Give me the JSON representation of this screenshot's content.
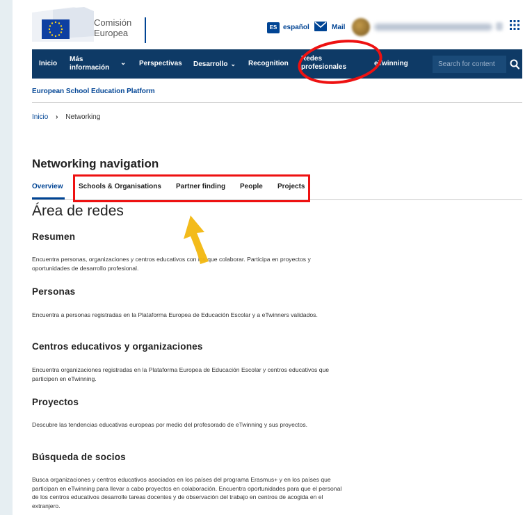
{
  "header": {
    "logo_line1": "Comisión",
    "logo_line2": "Europea",
    "lang_code": "ES",
    "lang_label": "español",
    "mail_label": "Mail"
  },
  "navbar": {
    "items": [
      "Inicio",
      "Más información",
      "Perspectivas",
      "Desarrollo",
      "Recognition",
      "Redes profesionales",
      "eTwinning"
    ],
    "search_placeholder": "Search for content"
  },
  "platform_title": "European School Education Platform",
  "breadcrumb": {
    "home": "Inicio",
    "current": "Networking"
  },
  "networking": {
    "title": "Networking navigation",
    "tabs": [
      "Overview",
      "Schools & Organisations",
      "Partner finding",
      "People",
      "Projects"
    ]
  },
  "content": {
    "title": "Área de redes",
    "sections": [
      {
        "heading": "Resumen",
        "text": "Encuentra personas, organizaciones y centros educativos con los que colaborar. Participa en proyectos y oportunidades de desarrollo profesional."
      },
      {
        "heading": "Personas",
        "text": "Encuentra a personas registradas en la Plataforma Europea de Educación Escolar y a eTwinners validados."
      },
      {
        "heading": "Centros educativos y organizaciones",
        "text": "Encuentra organizaciones registradas en la Plataforma Europea de Educación Escolar y centros educativos que participen en eTwinning."
      },
      {
        "heading": "Proyectos",
        "text": "Descubre las tendencias educativas europeas por medio del profesorado de eTwinning y sus proyectos."
      },
      {
        "heading": "Búsqueda de socios",
        "text": "Busca organizaciones y centros educativos asociados en los países del programa Erasmus+ y en los países que participan en eTwinning para llevar a cabo proyectos en colaboración. Encuentra oportunidades para que el personal de los centros educativos desarrolle tareas docentes y de observación del trabajo en centros de acogida en el extranjero."
      }
    ]
  },
  "colors": {
    "brand_blue": "#004494",
    "navbar": "#0e3a66",
    "highlight": "#e11111",
    "arrow": "#f2b70f"
  }
}
